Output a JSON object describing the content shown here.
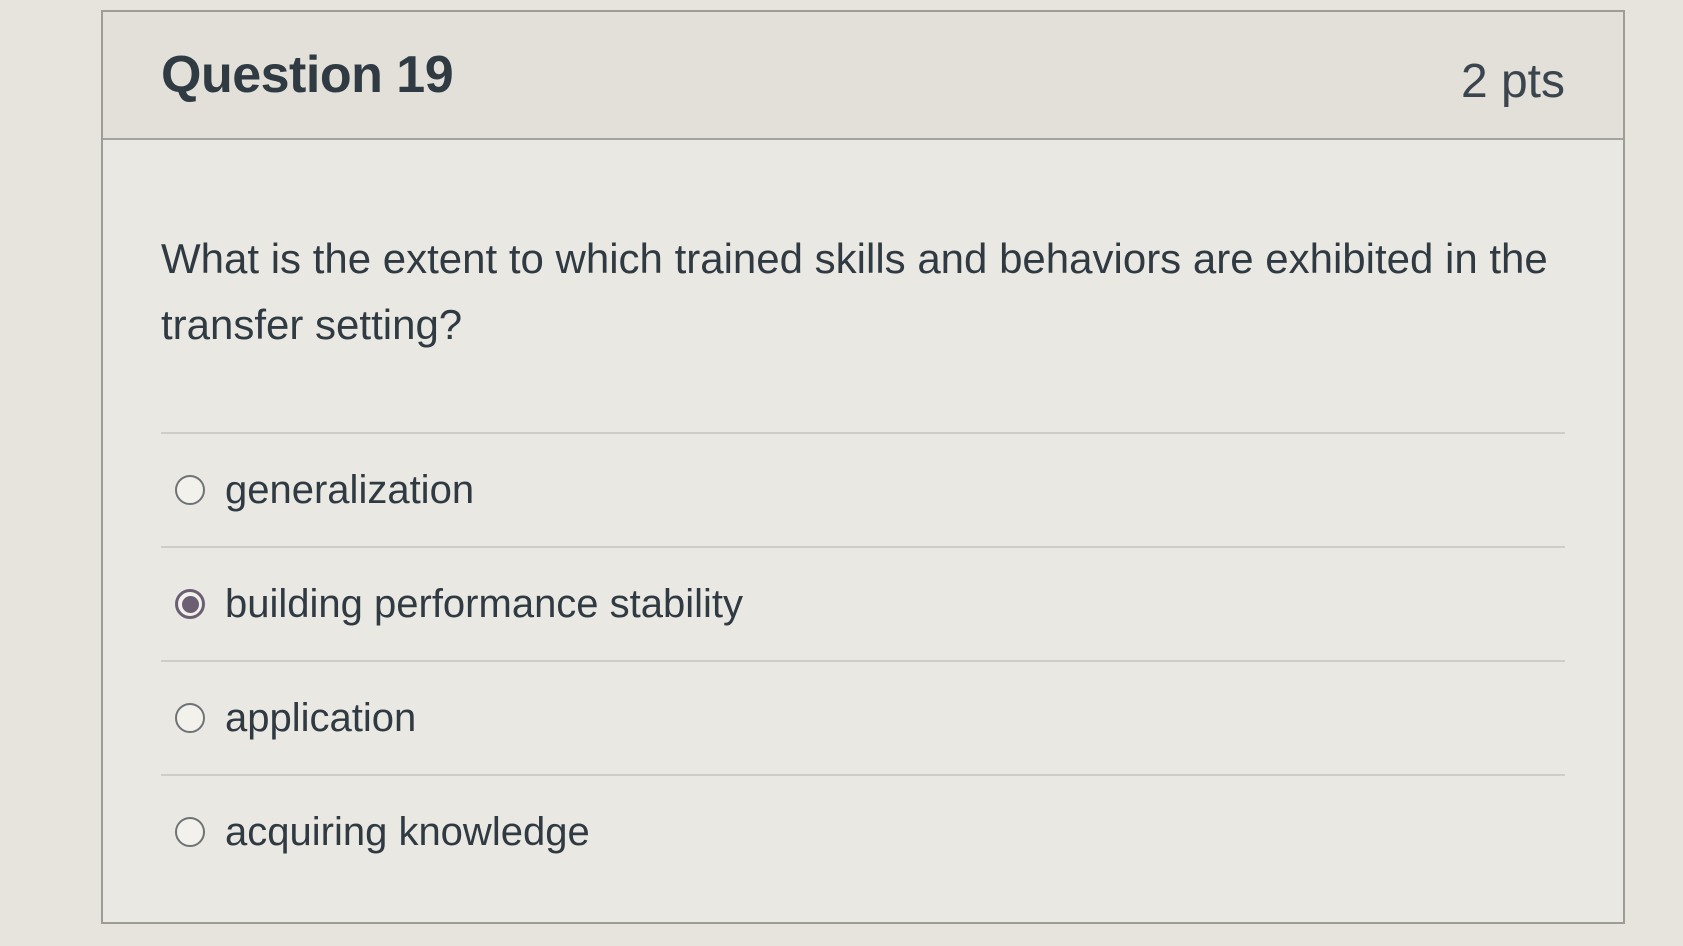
{
  "question": {
    "title": "Question 19",
    "points": "2 pts",
    "text": "What is the extent to which trained skills and behaviors are exhibited in the transfer setting?"
  },
  "answers": [
    {
      "label": "generalization",
      "selected": false
    },
    {
      "label": "building performance stability",
      "selected": true
    },
    {
      "label": "application",
      "selected": false
    },
    {
      "label": "acquiring knowledge",
      "selected": false
    }
  ],
  "colors": {
    "selected_radio": "#6d5f73",
    "text": "#2f3a42",
    "header_bg": "#e2e0d9"
  }
}
